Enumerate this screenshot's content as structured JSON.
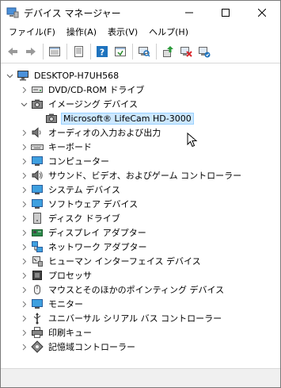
{
  "window": {
    "title": "デバイス マネージャー"
  },
  "menu": [
    "ファイル(F)",
    "操作(A)",
    "表示(V)",
    "ヘルプ(H)"
  ],
  "toolbar": {
    "buttons": [
      "back-arrow-icon",
      "forward-arrow-icon",
      "properties-list-icon",
      "properties-sheet-icon",
      "help-icon",
      "show-view-icon",
      "scan-hardware-icon",
      "update-driver-icon",
      "disable-device-icon",
      "uninstall-device-icon"
    ]
  },
  "tree": {
    "root": "DESKTOP-H7UH568",
    "items": [
      {
        "label": "DVD/CD-ROM ドライブ",
        "icon": "dvd-drive-icon",
        "expanded": false
      },
      {
        "label": "イメージング デバイス",
        "icon": "camera-icon",
        "expanded": true
      },
      {
        "label": "Microsoft® LifeCam HD-3000",
        "icon": "webcam-icon",
        "child": true,
        "selected": true
      },
      {
        "label": "オーディオの入力および出力",
        "icon": "speaker-icon",
        "expanded": false
      },
      {
        "label": "キーボード",
        "icon": "keyboard-icon",
        "expanded": false
      },
      {
        "label": "コンピューター",
        "icon": "computer-icon",
        "expanded": false
      },
      {
        "label": "サウンド、ビデオ、およびゲーム コントローラー",
        "icon": "sound-icon",
        "expanded": false
      },
      {
        "label": "システム デバイス",
        "icon": "system-device-icon",
        "expanded": false
      },
      {
        "label": "ソフトウェア デバイス",
        "icon": "software-device-icon",
        "expanded": false
      },
      {
        "label": "ディスク ドライブ",
        "icon": "disk-drive-icon",
        "expanded": false
      },
      {
        "label": "ディスプレイ アダプター",
        "icon": "display-adapter-icon",
        "expanded": false
      },
      {
        "label": "ネットワーク アダプター",
        "icon": "network-adapter-icon",
        "expanded": false
      },
      {
        "label": "ヒューマン インターフェイス デバイス",
        "icon": "hid-icon",
        "expanded": false
      },
      {
        "label": "プロセッサ",
        "icon": "processor-icon",
        "expanded": false
      },
      {
        "label": "マウスとそのほかのポインティング デバイス",
        "icon": "mouse-icon",
        "expanded": false
      },
      {
        "label": "モニター",
        "icon": "monitor-icon",
        "expanded": false
      },
      {
        "label": "ユニバーサル シリアル バス コントローラー",
        "icon": "usb-icon",
        "expanded": false
      },
      {
        "label": "印刷キュー",
        "icon": "printer-icon",
        "expanded": false
      },
      {
        "label": "記憶域コントローラー",
        "icon": "storage-controller-icon",
        "expanded": false
      }
    ]
  },
  "colors": {
    "selection_bg": "#cce8ff",
    "selection_border": "#99d1ff",
    "toolbar_blue": "#1e73be",
    "red_x": "#d9262b"
  }
}
